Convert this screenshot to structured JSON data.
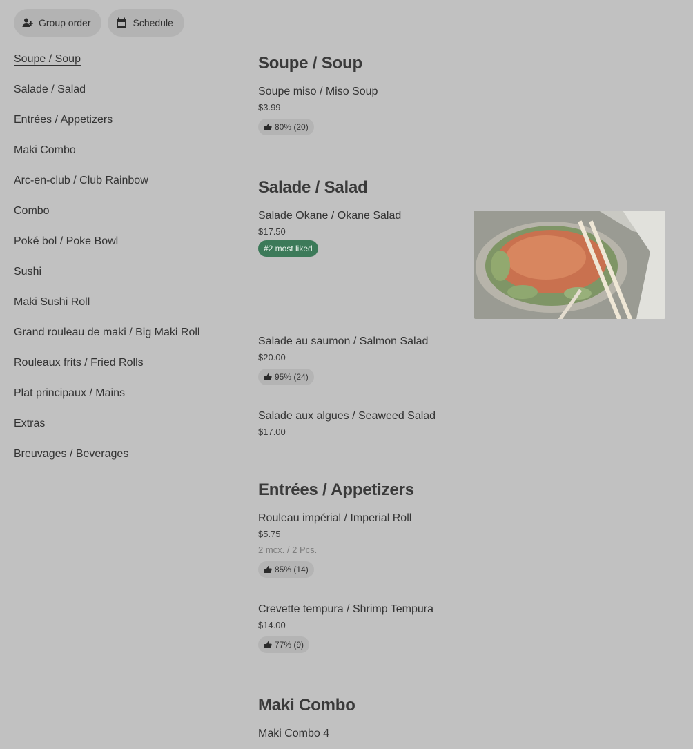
{
  "topbar": {
    "group_order": {
      "label": "Group order",
      "icon": "add-person-icon"
    },
    "schedule": {
      "label": "Schedule",
      "icon": "calendar-icon"
    }
  },
  "sidebar": {
    "items": [
      {
        "label": "Soupe / Soup",
        "active": true
      },
      {
        "label": "Salade / Salad"
      },
      {
        "label": "Entrées / Appetizers"
      },
      {
        "label": "Maki Combo"
      },
      {
        "label": "Arc-en-club / Club Rainbow"
      },
      {
        "label": "Combo"
      },
      {
        "label": "Poké bol / Poke Bowl"
      },
      {
        "label": "Sushi"
      },
      {
        "label": "Maki Sushi Roll"
      },
      {
        "label": "Grand rouleau de maki / Big Maki Roll"
      },
      {
        "label": "Rouleaux frits / Fried Rolls"
      },
      {
        "label": "Plat principaux / Mains"
      },
      {
        "label": "Extras"
      },
      {
        "label": "Breuvages / Beverages"
      }
    ]
  },
  "sections": {
    "soup": {
      "title": "Soupe / Soup",
      "items": [
        {
          "name": "Soupe miso / Miso Soup",
          "price": "$3.99",
          "rating": "80% (20)"
        }
      ]
    },
    "salad": {
      "title": "Salade / Salad",
      "items": [
        {
          "name": "Salade Okane / Okane Salad",
          "price": "$17.50",
          "badge": "#2 most liked"
        },
        {
          "name": "Salade au saumon / Salmon Salad",
          "price": "$20.00",
          "rating": "95% (24)"
        },
        {
          "name": "Salade aux algues / Seaweed Salad",
          "price": "$17.00"
        }
      ]
    },
    "appetizers": {
      "title": "Entrées / Appetizers",
      "items": [
        {
          "name": "Rouleau impérial / Imperial Roll",
          "price": "$5.75",
          "description": "2 mcx. / 2 Pcs.",
          "rating": "85% (14)"
        },
        {
          "name": "Crevette tempura / Shrimp Tempura",
          "price": "$14.00",
          "rating": "77% (9)"
        }
      ]
    },
    "maki_combo": {
      "title": "Maki Combo",
      "items": [
        {
          "name": "Maki Combo 4"
        }
      ]
    }
  },
  "colors": {
    "background": "#c1c1c1",
    "pill": "#b3b3b3",
    "badge": "#3c7a59"
  }
}
